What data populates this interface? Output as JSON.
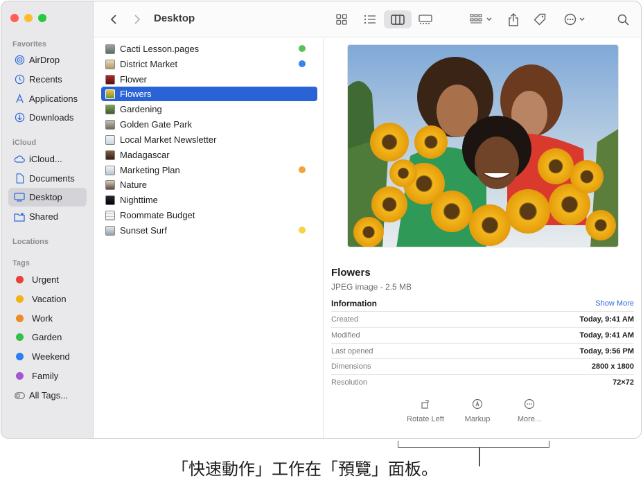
{
  "window": {
    "title": "Desktop",
    "traffic_lights": {
      "close": "#ff5f57",
      "minimize": "#febc2e",
      "zoom": "#28c840"
    }
  },
  "sidebar": {
    "favorites_header": "Favorites",
    "favorites": [
      {
        "label": "AirDrop",
        "icon": "airdrop-icon"
      },
      {
        "label": "Recents",
        "icon": "clock-icon"
      },
      {
        "label": "Applications",
        "icon": "applications-icon"
      },
      {
        "label": "Downloads",
        "icon": "download-icon"
      }
    ],
    "icloud_header": "iCloud",
    "icloud": [
      {
        "label": "iCloud...",
        "icon": "cloud-icon"
      },
      {
        "label": "Documents",
        "icon": "document-icon"
      },
      {
        "label": "Desktop",
        "icon": "desktop-icon",
        "selected": true
      },
      {
        "label": "Shared",
        "icon": "shared-folder-icon"
      }
    ],
    "locations_header": "Locations",
    "tags_header": "Tags",
    "tags": [
      {
        "label": "Urgent",
        "color": "#ec3f36"
      },
      {
        "label": "Vacation",
        "color": "#f2b411"
      },
      {
        "label": "Work",
        "color": "#f08a24"
      },
      {
        "label": "Garden",
        "color": "#33c04a"
      },
      {
        "label": "Weekend",
        "color": "#2d7ef0"
      },
      {
        "label": "Family",
        "color": "#a557d2"
      }
    ],
    "all_tags": "All Tags..."
  },
  "files": [
    {
      "name": "Cacti Lesson.pages",
      "tag": "#5ac05a"
    },
    {
      "name": "District Market",
      "tag": "#3b82ef"
    },
    {
      "name": "Flower",
      "tag": null
    },
    {
      "name": "Flowers",
      "tag": null,
      "selected": true
    },
    {
      "name": "Gardening",
      "tag": null
    },
    {
      "name": "Golden Gate Park",
      "tag": null
    },
    {
      "name": "Local Market Newsletter",
      "tag": null
    },
    {
      "name": "Madagascar",
      "tag": null
    },
    {
      "name": "Marketing Plan",
      "tag": "#f4a23c"
    },
    {
      "name": "Nature",
      "tag": null
    },
    {
      "name": "Nighttime",
      "tag": null
    },
    {
      "name": "Roommate Budget",
      "tag": null
    },
    {
      "name": "Sunset Surf",
      "tag": "#f5d442"
    }
  ],
  "preview": {
    "name": "Flowers",
    "kind": "JPEG image - 2.5 MB",
    "info_header": "Information",
    "show_more": "Show More",
    "info": [
      {
        "key": "Created",
        "value": "Today, 9:41 AM"
      },
      {
        "key": "Modified",
        "value": "Today, 9:41 AM"
      },
      {
        "key": "Last opened",
        "value": "Today, 9:56 PM"
      },
      {
        "key": "Dimensions",
        "value": "2800 x 1800"
      },
      {
        "key": "Resolution",
        "value": "72×72"
      }
    ],
    "quick_actions": [
      {
        "label": "Rotate Left",
        "icon": "rotate-left-icon"
      },
      {
        "label": "Markup",
        "icon": "markup-icon"
      },
      {
        "label": "More...",
        "icon": "more-icon"
      }
    ]
  },
  "caption": "「快速動作」工作在「預覽」面板。"
}
